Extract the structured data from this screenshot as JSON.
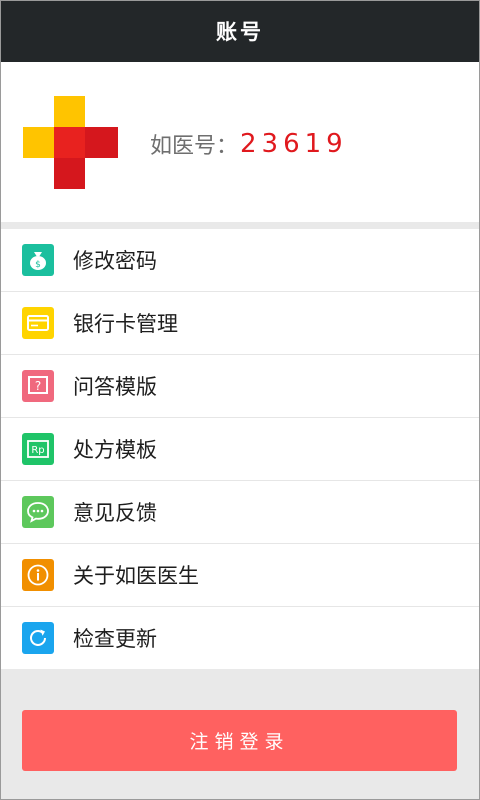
{
  "header": {
    "title": "账号"
  },
  "profile": {
    "label": "如医号：",
    "number": "23619"
  },
  "menu": {
    "items": [
      {
        "label": "修改密码",
        "icon": "money-bag-icon",
        "color": "#1bbf9e"
      },
      {
        "label": "银行卡管理",
        "icon": "bank-card-icon",
        "color": "#ffd400"
      },
      {
        "label": "问答模版",
        "icon": "question-icon",
        "color": "#f0697e"
      },
      {
        "label": "处方模板",
        "icon": "rp-icon",
        "color": "#1fc468"
      },
      {
        "label": "意见反馈",
        "icon": "chat-bubble-icon",
        "color": "#5dc85c"
      },
      {
        "label": "关于如医医生",
        "icon": "info-icon",
        "color": "#f18f00"
      },
      {
        "label": "检查更新",
        "icon": "refresh-icon",
        "color": "#1aa5ee"
      }
    ]
  },
  "logout": {
    "label": "注销登录",
    "color": "#ff6160"
  }
}
